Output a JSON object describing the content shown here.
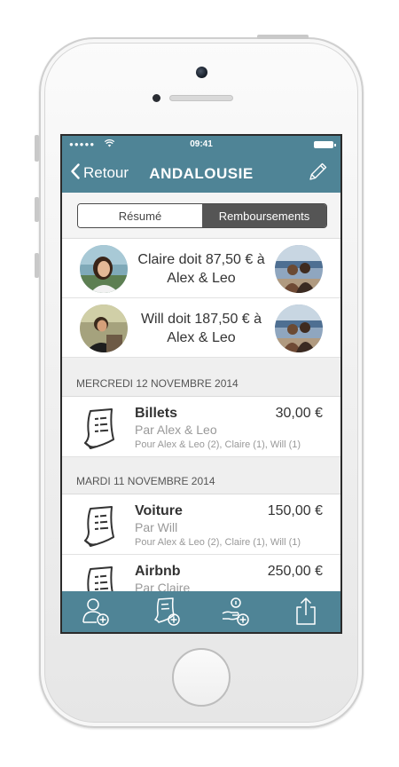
{
  "status_bar": {
    "signal": "●●●●●",
    "time": "09:41"
  },
  "nav": {
    "back_label": "Retour",
    "title": "ANDALOUSIE"
  },
  "segmented": {
    "summary_label": "Résumé",
    "reimbursements_label": "Remboursements",
    "selected": "Remboursements"
  },
  "debts": [
    {
      "text": "Claire doit 87,50 € à Alex & Leo"
    },
    {
      "text": "Will doit 187,50 € à Alex & Leo"
    }
  ],
  "sections": [
    {
      "date": "MERCREDI 12 NOVEMBRE 2014",
      "expenses": [
        {
          "name": "Billets",
          "amount": "30,00 €",
          "payer": "Par Alex & Leo",
          "split": "Pour Alex & Leo (2), Claire (1), Will (1)"
        }
      ]
    },
    {
      "date": "MARDI 11 NOVEMBRE 2014",
      "expenses": [
        {
          "name": "Voiture",
          "amount": "150,00 €",
          "payer": "Par Will",
          "split": "Pour Alex & Leo (2), Claire (1), Will (1)"
        },
        {
          "name": "Airbnb",
          "amount": "250,00 €",
          "payer": "Par Claire",
          "split": ""
        }
      ]
    }
  ],
  "tabbar": {
    "icons": [
      "add-person-icon",
      "add-expense-icon",
      "add-reimbursement-icon",
      "share-icon"
    ]
  },
  "colors": {
    "header": "#4f8496",
    "segment_active": "#555555"
  }
}
